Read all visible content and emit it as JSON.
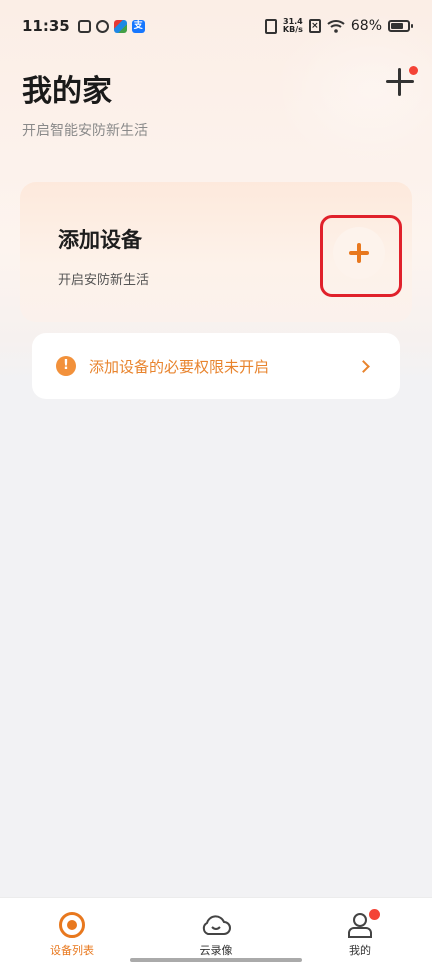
{
  "status_bar": {
    "time": "11:35",
    "net_speed_value": "31.4",
    "net_speed_unit": "KB/s",
    "battery_percent": "68%",
    "notif_d_label": "支"
  },
  "header": {
    "title": "我的家",
    "subtitle": "开启智能安防新生活"
  },
  "add_card": {
    "title": "添加设备",
    "subtitle": "开启安防新生活"
  },
  "permission_banner": {
    "text": "添加设备的必要权限未开启",
    "warn_symbol": "!"
  },
  "bottom_nav": {
    "items": [
      {
        "label": "设备列表",
        "icon": "devices-icon",
        "active": true
      },
      {
        "label": "云录像",
        "icon": "cloud-icon",
        "active": false
      },
      {
        "label": "我的",
        "icon": "user-icon",
        "active": false
      }
    ]
  },
  "colors": {
    "accent": "#e8781e",
    "badge": "#f44336",
    "highlight": "#e0212b"
  }
}
